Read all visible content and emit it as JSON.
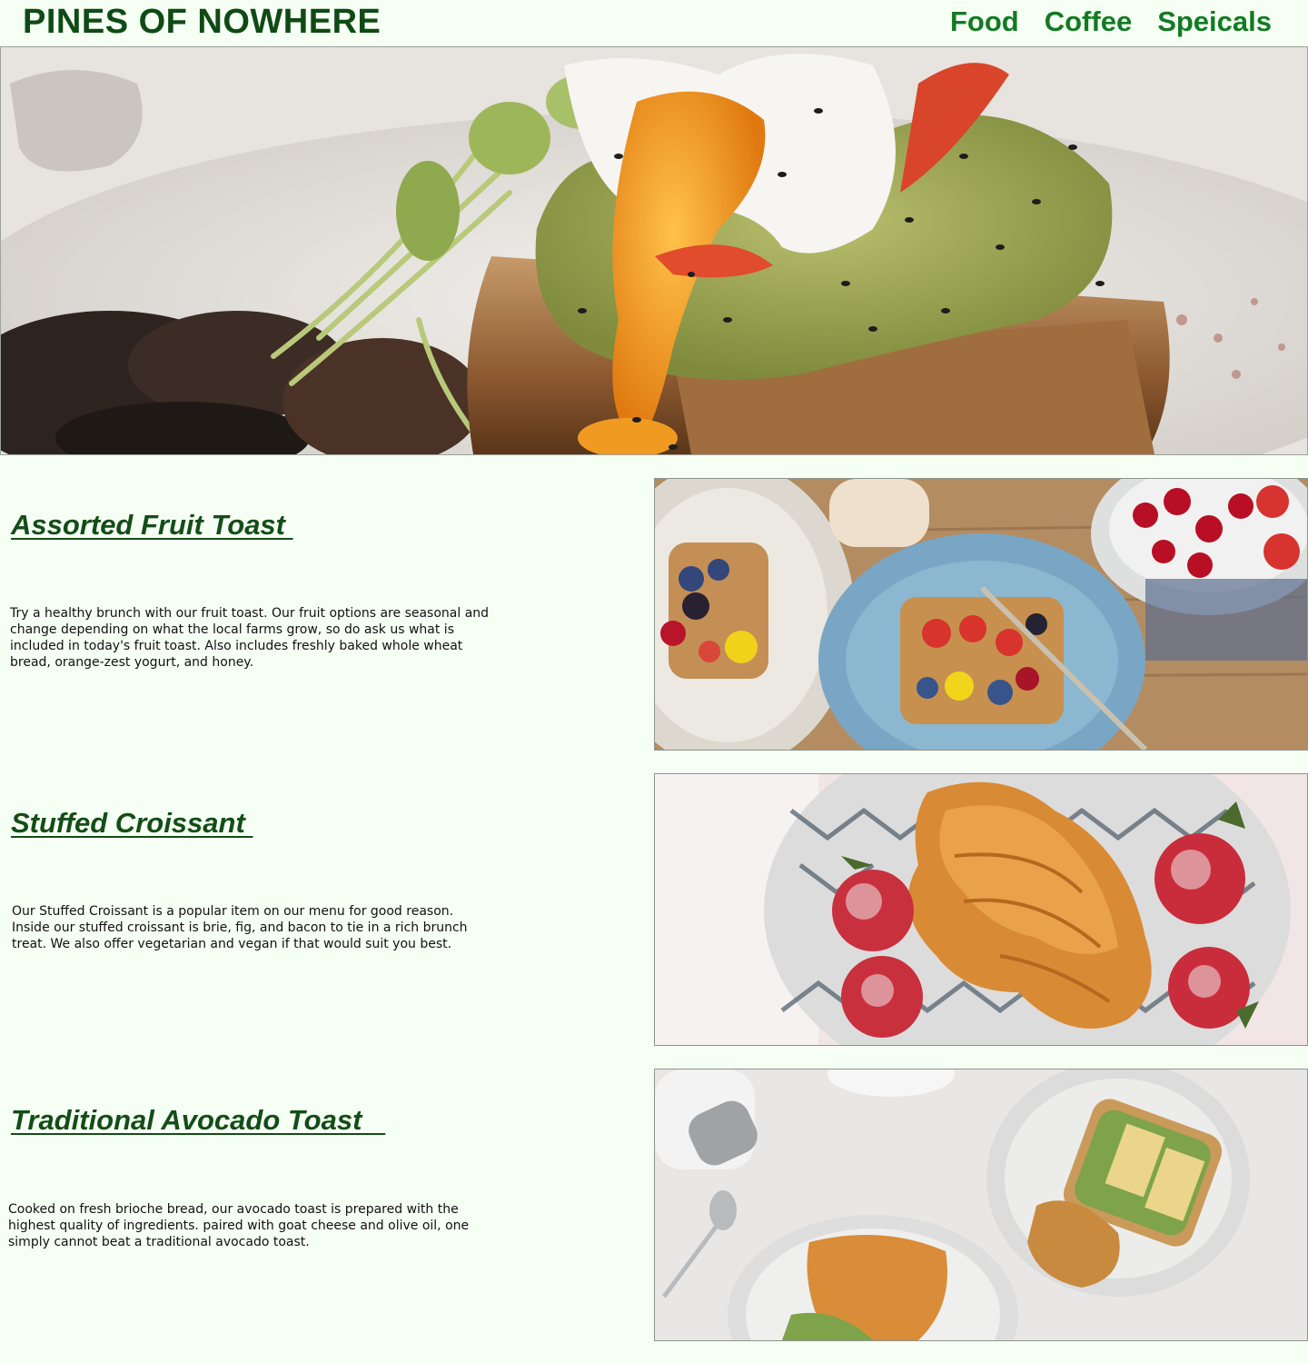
{
  "header": {
    "brand": "PINES OF NOWHERE",
    "nav": [
      {
        "label": "Food"
      },
      {
        "label": "Coffee"
      },
      {
        "label": "Speicals"
      }
    ]
  },
  "menu": [
    {
      "title": "Assorted Fruit Toast ",
      "description": "Try a healthy brunch with our fruit toast. Our fruit options are seasonal and change depending on what the local farms grow, so do ask us what is included in today's fruit toast. Also includes freshly baked whole wheat bread, orange-zest yogurt, and honey."
    },
    {
      "title": "Stuffed Croissant ",
      "description": "Our Stuffed Croissant is a popular item on our menu for good reason. Inside our stuffed croissant is brie, fig, and bacon to tie in a rich brunch treat. We also offer vegetarian and vegan if that would suit you best."
    },
    {
      "title": "Traditional Avocado Toast   ",
      "description": "Cooked on fresh brioche bread, our avocado toast is prepared with the highest quality of ingredients. paired with goat cheese and olive oil, one simply cannot beat a traditional avocado toast."
    }
  ],
  "colors": {
    "background": "#f6fff4",
    "brand": "#0f4a14",
    "nav": "#137a23",
    "heading": "#134d17"
  }
}
